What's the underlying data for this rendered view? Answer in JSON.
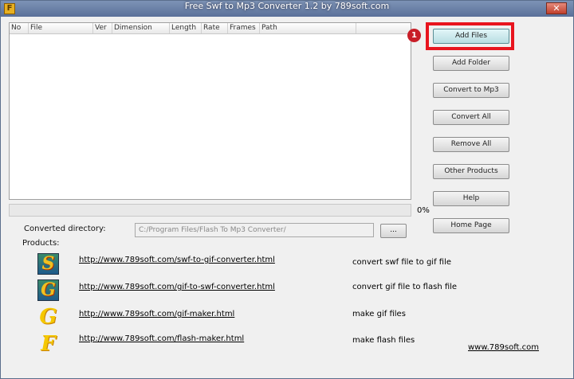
{
  "window": {
    "title": "Free Swf to Mp3 Converter 1.2 by 789soft.com",
    "app_icon_glyph": "F",
    "close_glyph": "✕"
  },
  "list": {
    "columns": [
      "No",
      "File",
      "Ver",
      "Dimension",
      "Length",
      "Rate",
      "Frames",
      "Path"
    ]
  },
  "progress": {
    "percent_label": "0%",
    "value": 0
  },
  "buttons": {
    "add_files": "Add Files",
    "add_folder": "Add Folder",
    "convert_to_mp3": "Convert to Mp3",
    "convert_all": "Convert All",
    "remove_all": "Remove All",
    "other_products": "Other Products",
    "help": "Help",
    "home_page": "Home Page",
    "browse": "..."
  },
  "annotation": {
    "badge_number": "1",
    "highlight_color": "#e8141e"
  },
  "output": {
    "label": "Converted directory:",
    "value": "C:/Program Files/Flash To Mp3 Converter/"
  },
  "products": {
    "label": "Products:",
    "items": [
      {
        "icon": "S",
        "url": "http://www.789soft.com/swf-to-gif-converter.html",
        "desc": "convert swf file to gif file"
      },
      {
        "icon": "G",
        "url": "http://www.789soft.com/gif-to-swf-converter.html",
        "desc": "convert gif file to flash file"
      },
      {
        "icon": "G",
        "url": "http://www.789soft.com/gif-maker.html",
        "desc": "make gif files"
      },
      {
        "icon": "F",
        "url": "http://www.789soft.com/flash-maker.html",
        "desc": "make flash files"
      }
    ]
  },
  "footer": {
    "site_link": "www.789soft.com"
  }
}
